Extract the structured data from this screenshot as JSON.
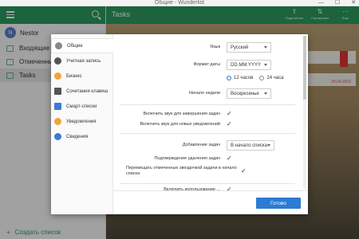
{
  "window": {
    "title": "Общие - Wunderlist",
    "controls": [
      "—",
      "☐",
      "✕"
    ]
  },
  "sidebar": {
    "user": {
      "initial": "N",
      "name": "Nestor"
    },
    "items": [
      {
        "label": "Входящие",
        "active": false
      },
      {
        "label": "Отмеченные",
        "active": false
      },
      {
        "label": "Tasks",
        "active": true
      }
    ],
    "create_list": "Создать список"
  },
  "main": {
    "title": "Tasks",
    "actions": [
      {
        "label": "Поделиться",
        "icon": "share-icon"
      },
      {
        "label": "Сортировка",
        "icon": "sort-icon"
      },
      {
        "label": "Еще",
        "icon": "more-icon"
      }
    ],
    "task_date": "29.04.2016"
  },
  "settings": {
    "nav": [
      {
        "label": "Общие",
        "icon": "gear-icon",
        "color": "#888888",
        "active": true
      },
      {
        "label": "Учетная запись",
        "icon": "user-icon",
        "color": "#555555",
        "active": false
      },
      {
        "label": "Бизнес",
        "icon": "business-icon",
        "color": "#f2a33a",
        "active": false
      },
      {
        "label": "Сочетания клавиш",
        "icon": "keyboard-icon",
        "color": "#555555",
        "active": false
      },
      {
        "label": "Смарт-списки",
        "icon": "smart-list-icon",
        "color": "#3a7bd5",
        "active": false
      },
      {
        "label": "Уведомления",
        "icon": "bell-icon",
        "color": "#f2a33a",
        "active": false
      },
      {
        "label": "Сведения",
        "icon": "info-icon",
        "color": "#3a7bd5",
        "active": false
      }
    ],
    "language": {
      "label": "Язык",
      "value": "Русский"
    },
    "date_format": {
      "label": "Формат даты",
      "value": "DD.MM.YYYY"
    },
    "time_format": {
      "options": [
        "12 часов",
        "24 часа"
      ],
      "selected": "12 часов"
    },
    "week_start": {
      "label": "Начало недели",
      "value": "Воскресенье"
    },
    "sound_complete": {
      "label": "Включить звук для завершения задач",
      "checked": true
    },
    "sound_notify": {
      "label": "Включить звук для новых уведомлений",
      "checked": true
    },
    "add_tasks": {
      "label": "Добавление задач",
      "value": "В начало списка"
    },
    "confirm_delete": {
      "label": "Подтверждение удаления задач",
      "checked": true
    },
    "move_starred": {
      "label": "Перемещать отмеченные звездочкой задачи в начало списка",
      "checked": true
    },
    "cut_off_row": {
      "label": "Включить использование ...",
      "checked": true
    },
    "done_button": "Готово"
  }
}
